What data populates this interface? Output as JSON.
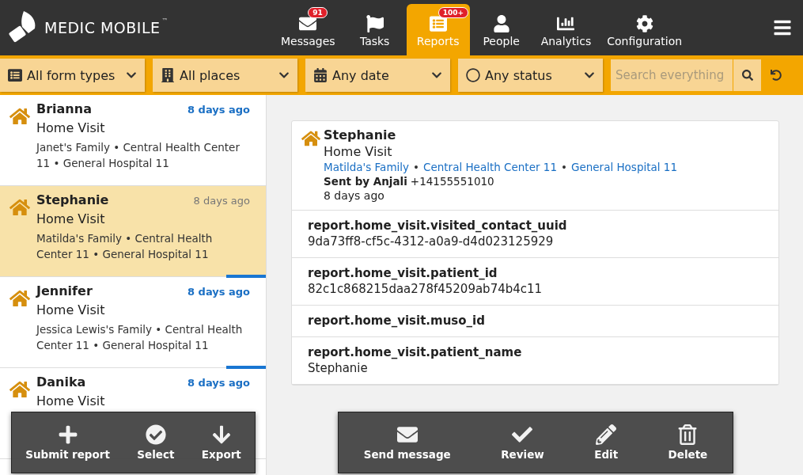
{
  "brand": {
    "name": "MEDIC MOBILE",
    "mark": "™"
  },
  "tabs": [
    {
      "kind": "messages",
      "label": "Messages",
      "badge": "91",
      "selected": false
    },
    {
      "kind": "tasks",
      "label": "Tasks",
      "selected": false
    },
    {
      "kind": "reports",
      "label": "Reports",
      "badge": "100+",
      "selected": true
    },
    {
      "kind": "people",
      "label": "People",
      "selected": false
    },
    {
      "kind": "analytics",
      "label": "Analytics",
      "selected": false
    },
    {
      "kind": "configuration",
      "label": "Configuration",
      "selected": false
    }
  ],
  "filters": [
    {
      "kind": "forms",
      "label": "All form types"
    },
    {
      "kind": "places",
      "label": "All places"
    },
    {
      "kind": "date",
      "label": "Any date"
    },
    {
      "kind": "status",
      "label": "Any status"
    }
  ],
  "search": {
    "placeholder": "Search everything"
  },
  "reports": [
    {
      "name": "Brianna",
      "form": "Home Visit",
      "places": "Janet's Family • Central Health Center 11 • General Hospital 11",
      "time": "8 days ago",
      "unread": true,
      "selected": false
    },
    {
      "name": "Stephanie",
      "form": "Home Visit",
      "places": "Matilda's Family • Central Health Center 11 • General Hospital 11",
      "time": "8 days ago",
      "unread": false,
      "selected": true
    },
    {
      "name": "Jennifer",
      "form": "Home Visit",
      "places": "Jessica Lewis's Family • Central Health Center 11 • General Hospital 11",
      "time": "8 days ago",
      "unread": true,
      "selected": false
    },
    {
      "name": "Danika",
      "form": "Home Visit",
      "time": "8 days ago",
      "unread": true,
      "selected": false
    }
  ],
  "list_actions": [
    {
      "kind": "submit",
      "label": "Submit report"
    },
    {
      "kind": "select",
      "label": "Select"
    },
    {
      "kind": "export",
      "label": "Export"
    }
  ],
  "detail": {
    "name": "Stephanie",
    "form": "Home Visit",
    "places": [
      "Matilda's Family",
      "Central Health Center 11",
      "General Hospital 11"
    ],
    "separators": [
      "•",
      "•"
    ],
    "sent_by": "Sent by Anjali",
    "phone": "+14155551010",
    "time": "8 days ago",
    "fields": [
      {
        "label": "report.home_visit.visited_contact_uuid",
        "value": "9da73ff8-cf5c-4312-a0a9-d4d023125929"
      },
      {
        "label": "report.home_visit.patient_id",
        "value": "82c1c868215daa278f45209ab74b4c11"
      },
      {
        "label": "report.home_visit.muso_id"
      },
      {
        "label": "report.home_visit.patient_name",
        "value": "Stephanie"
      }
    ]
  },
  "detail_actions": [
    {
      "kind": "message",
      "label": "Send message"
    },
    {
      "kind": "review",
      "label": "Review"
    },
    {
      "kind": "edit",
      "label": "Edit"
    },
    {
      "kind": "delete",
      "label": "Delete"
    }
  ]
}
